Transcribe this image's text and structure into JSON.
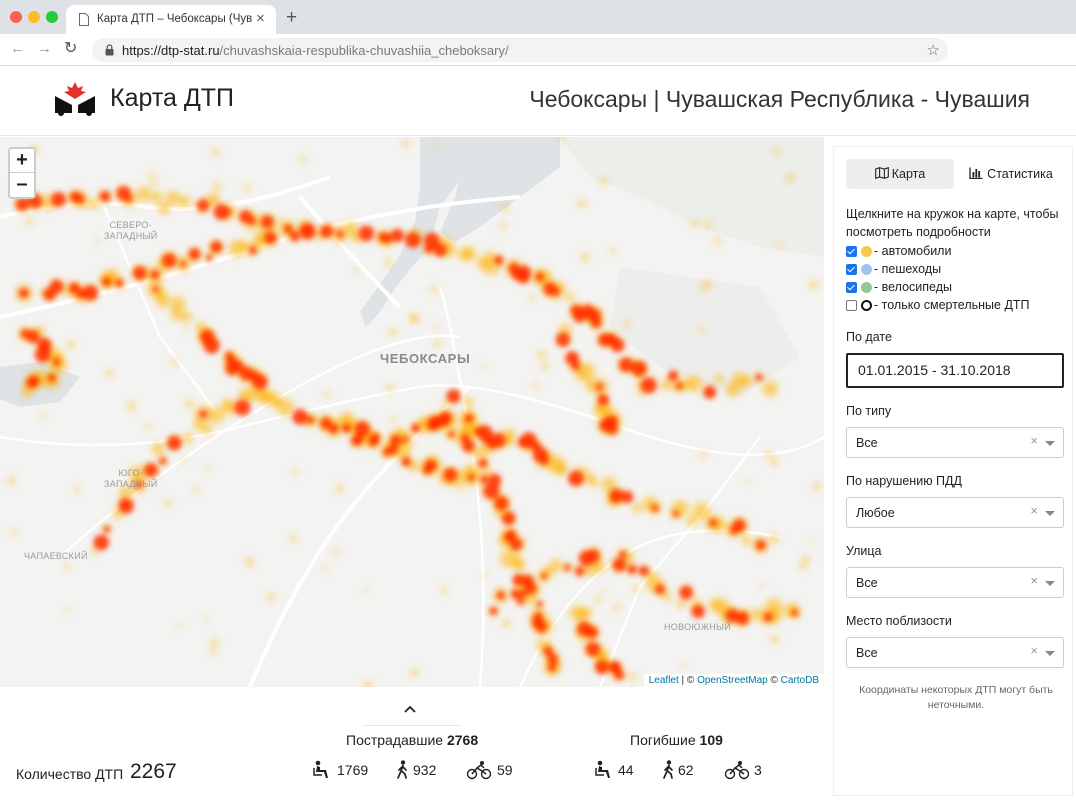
{
  "browser": {
    "tab_title": "Карта ДТП – Чебоксары (Чувашская",
    "url_host": "https://dtp-stat.ru",
    "url_path": "/chuvashskaia-respublika-chuvashiia_cheboksary/"
  },
  "header": {
    "logo_text": "Карта ДТП",
    "region_title": "Чебоксары | Чувашская Республика - Чувашия"
  },
  "map": {
    "zoom_in": "+",
    "zoom_out": "–",
    "labels": {
      "city": "ЧЕБОКСАРЫ",
      "nw_1": "СЕВЕРО-",
      "nw_2": "ЗАПАДНЫЙ",
      "sw_1": "ЮГО-",
      "sw_2": "ЗАПАДНЫЙ",
      "chap": "ЧАПАЕВСКИЙ",
      "novo": "НОВОЮЖНЫЙ"
    },
    "attribution": {
      "leaflet": "Leaflet",
      "sep1": " | © ",
      "osm": "OpenStreetMap",
      "sep2": " © ",
      "carto": "CartoDB"
    },
    "colors": {
      "hot": "#ff2a00",
      "warm": "#ffb300",
      "water": "#dfe3e6",
      "road": "#ffffff"
    }
  },
  "sidebar": {
    "tabs": {
      "map": "Карта",
      "stats": "Статистика"
    },
    "hint": "Щелкните на кружок на карте, чтобы посмотреть подробности",
    "legend": [
      {
        "text": "- автомобили",
        "checked": true,
        "color": "#f6c94c"
      },
      {
        "text": "- пешеходы",
        "checked": true,
        "color": "#9ec3f0"
      },
      {
        "text": "- велосипеды",
        "checked": true,
        "color": "#8fc79a"
      },
      {
        "text": "- только смертельные ДТП",
        "checked": false,
        "color": "#111111"
      }
    ],
    "date": {
      "label": "По дате",
      "value": "01.01.2015 - 31.10.2018"
    },
    "type": {
      "label": "По типу",
      "value": "Все"
    },
    "violation": {
      "label": "По нарушению ПДД",
      "value": "Любое"
    },
    "street": {
      "label": "Улица",
      "value": "Все"
    },
    "nearby": {
      "label": "Место поблизости",
      "value": "Все"
    },
    "note": "Координаты некоторых ДТП могут быть неточными.",
    "clear_symbol": "×"
  },
  "stats": {
    "count_label": "Количество ДТП",
    "count_value": "2267",
    "injured": {
      "title": "Пострадавшие",
      "total": "2768",
      "drivers": "1769",
      "pedestrians": "932",
      "cyclists": "59"
    },
    "dead": {
      "title": "Погибшие",
      "total": "109",
      "drivers": "44",
      "pedestrians": "62",
      "cyclists": "3"
    }
  }
}
